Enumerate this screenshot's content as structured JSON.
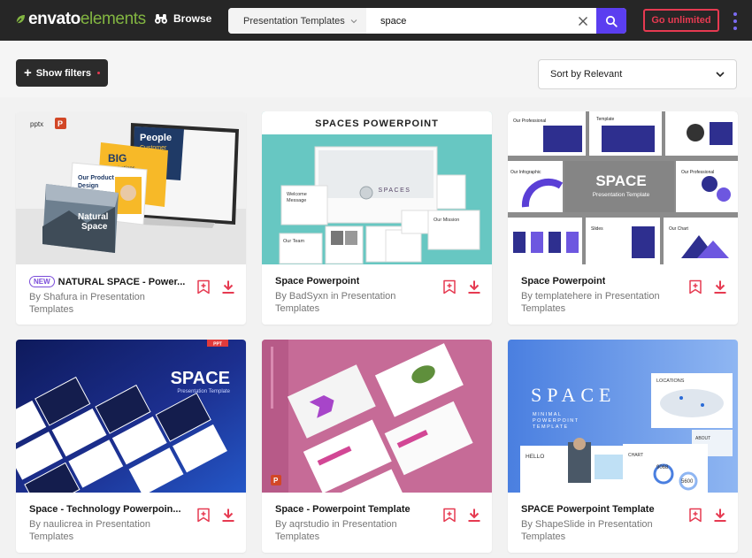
{
  "header": {
    "logo": {
      "part1": "envato",
      "part2": "elements"
    },
    "browse_label": "Browse",
    "category_label": "Presentation Templates",
    "search_value": "space",
    "go_label": "Go unlimited"
  },
  "controls": {
    "filters_label": "Show filters",
    "sort_label": "Sort by Relevant"
  },
  "thumbnails": {
    "c1": {
      "tag": "pptx",
      "big": "BIG",
      "big2": "Inspirations",
      "people": "People",
      "people2": "Customer",
      "product": "Our Product",
      "product2": "Design",
      "natural": "Natural",
      "natural2": "Space"
    },
    "c2": {
      "heading": "SPACES POWERPOINT",
      "logo": "SPACES",
      "welcome": "Welcome",
      "welcome2": "Message",
      "mission": "Our Mission",
      "team": "Our Team"
    },
    "c3": {
      "title": "SPACE",
      "subtitle": "Presentation Template",
      "prof": "Our Professional",
      "prof2": "Template",
      "info": "Our Infographic",
      "info2": "Slides",
      "chart": "Our Chart"
    },
    "c4": {
      "title": "SPACE",
      "subtitle": "Presentation Template",
      "badge": "PPT"
    },
    "c5": {},
    "c6": {
      "title": "SPACE",
      "sub1": "MINIMAL",
      "sub2": "POWERPOINT",
      "sub3": "TEMPLATE",
      "locations": "LOCATIONS",
      "hello": "HELLO",
      "about": "ABOUT",
      "chart": "CHART",
      "n1": "9068",
      "n2": "5600"
    }
  },
  "cards": [
    {
      "new_badge": "NEW",
      "title": "NATURAL SPACE - Power...",
      "by": "By",
      "author": "Shafura",
      "in": "in",
      "category": "Presentation Templates"
    },
    {
      "title": "Space Powerpoint",
      "by": "By",
      "author": "BadSyxn",
      "in": "in",
      "category": "Presentation Templates"
    },
    {
      "title": "Space Powerpoint",
      "by": "By",
      "author": "templatehere",
      "in": "in",
      "category": "Presentation Templates"
    },
    {
      "title": "Space - Technology Powerpoin...",
      "by": "By",
      "author": "naulicrea",
      "in": "in",
      "category": "Presentation Templates"
    },
    {
      "title": "Space - Powerpoint Template",
      "by": "By",
      "author": "aqrstudio",
      "in": "in",
      "category": "Presentation Templates"
    },
    {
      "title": "SPACE Powerpoint Template",
      "by": "By",
      "author": "ShapeSlide",
      "in": "in",
      "category": "Presentation Templates"
    }
  ],
  "icons": [
    "leaf-icon",
    "binoculars-icon",
    "chevron-down-icon",
    "close-icon",
    "search-icon",
    "plus-icon",
    "bookmark-add-icon",
    "download-icon",
    "powerpoint-icon"
  ],
  "colors": {
    "brand_green": "#82b541",
    "accent_purple": "#5b3ef0",
    "accent_red": "#e63a51",
    "header_bg": "#262626"
  }
}
